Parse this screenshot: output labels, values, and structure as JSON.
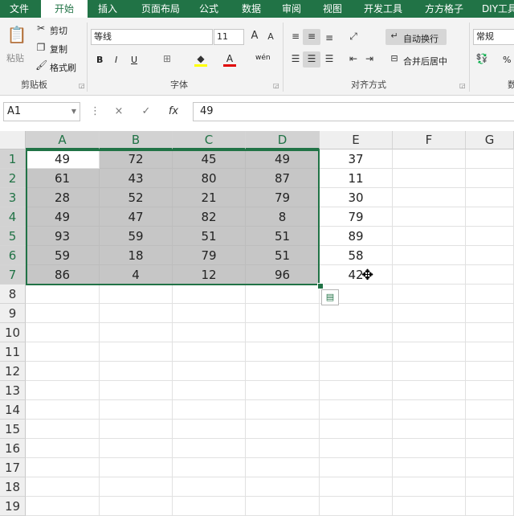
{
  "tabs": [
    "文件",
    "开始",
    "插入",
    "页面布局",
    "公式",
    "数据",
    "审阅",
    "视图",
    "开发工具",
    "方方格子",
    "DIY工具"
  ],
  "active_tab": "开始",
  "ribbon": {
    "clipboard": {
      "paste": "粘贴",
      "cut": "剪切",
      "copy": "复制",
      "format_painter": "格式刷",
      "label": "剪贴板"
    },
    "font": {
      "name": "等线",
      "size": "11",
      "bold": "B",
      "italic": "I",
      "underline": "U",
      "phonetic": "wén",
      "label": "字体"
    },
    "alignment": {
      "wrap_text": "自动换行",
      "merge_center": "合并后居中",
      "label": "对齐方式"
    },
    "number": {
      "format": "常规",
      "percent": "%",
      "label": "数"
    }
  },
  "formula_bar": {
    "name_box": "A1",
    "cancel": "×",
    "enter": "✓",
    "fx": "fx",
    "value": "49"
  },
  "columns": [
    "A",
    "B",
    "C",
    "D",
    "E",
    "F",
    "G"
  ],
  "rows": [
    "1",
    "2",
    "3",
    "4",
    "5",
    "6",
    "7",
    "8",
    "9",
    "10",
    "11",
    "12",
    "13",
    "14",
    "15",
    "16",
    "17",
    "18",
    "19"
  ],
  "cells": [
    [
      "49",
      "72",
      "45",
      "49",
      "37"
    ],
    [
      "61",
      "43",
      "80",
      "87",
      "11"
    ],
    [
      "28",
      "52",
      "21",
      "79",
      "30"
    ],
    [
      "49",
      "47",
      "82",
      "8",
      "79"
    ],
    [
      "93",
      "59",
      "51",
      "51",
      "89"
    ],
    [
      "59",
      "18",
      "79",
      "51",
      "58"
    ],
    [
      "86",
      "4",
      "12",
      "96",
      "42"
    ]
  ],
  "selection": {
    "range": "A1:D7",
    "active_cell": "A1"
  },
  "colors": {
    "brand": "#217346",
    "selection_fill": "#c6c6c6"
  },
  "icons": {
    "quick_analysis": "quick-analysis-icon",
    "cursor": "move-cursor-icon"
  }
}
